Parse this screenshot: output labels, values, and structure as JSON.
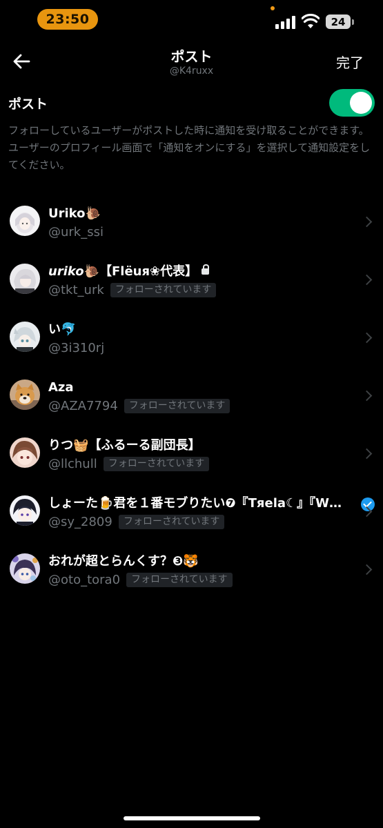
{
  "status_bar": {
    "time": "23:50",
    "battery": "24"
  },
  "header": {
    "title": "ポスト",
    "subtitle": "@K4ruxx",
    "done_label": "完了"
  },
  "setting": {
    "label": "ポスト",
    "toggle_on": true,
    "description": "フォローしているユーザーがポストした時に通知を受け取ることができます。ユーザーのプロフィール画面で「通知をオンにする」を選択して通知設定をしてください。"
  },
  "follow_badge_label": "フォローされています",
  "users": [
    {
      "name": "Uriko🐌",
      "handle": "@urk_ssi",
      "follows_you": false,
      "avatar": "anime-white-hair"
    },
    {
      "name_italic": "uriko",
      "name_rest": "🐌【Flëuя❀代表】",
      "handle": "@tkt_urk",
      "follows_you": true,
      "locked": true,
      "avatar": "anime-white-hair-2"
    },
    {
      "name": "い🐬",
      "handle": "@3i310rj",
      "follows_you": false,
      "avatar": "anime-white-cat"
    },
    {
      "name": "Aza",
      "handle": "@AZA7794",
      "follows_you": true,
      "avatar": "shiba-dog"
    },
    {
      "name": "りつ🧺【ふるーる副団長】",
      "handle": "@llchull",
      "follows_you": true,
      "avatar": "anime-brown-hair"
    },
    {
      "name": "しょーた🍺君を１番モブりたい❼『Tяela☾』『W…",
      "handle": "@sy_2809",
      "follows_you": true,
      "verified": true,
      "avatar": "anime-black-hair"
    },
    {
      "name": "おれが超とらんくす？❸🐯",
      "handle": "@oto_tora0",
      "follows_you": true,
      "avatar": "anime-colorful"
    }
  ]
}
